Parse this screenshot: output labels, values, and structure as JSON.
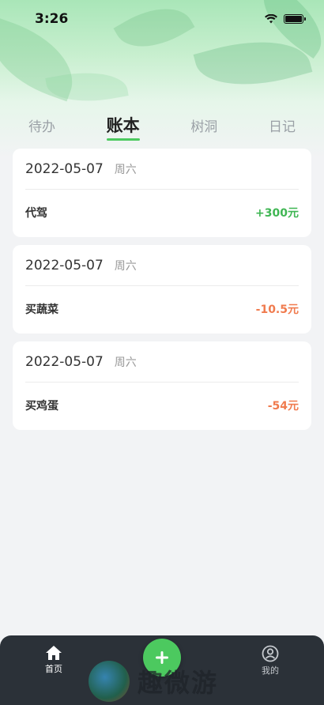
{
  "status_bar": {
    "time": "3:26"
  },
  "tabs": [
    {
      "label": "待办",
      "active": false
    },
    {
      "label": "账本",
      "active": true
    },
    {
      "label": "树洞",
      "active": false
    },
    {
      "label": "日记",
      "active": false
    }
  ],
  "entries": [
    {
      "date": "2022-05-07",
      "weekday": "周六",
      "item": "代驾",
      "amount": "+300元",
      "type": "income"
    },
    {
      "date": "2022-05-07",
      "weekday": "周六",
      "item": "买蔬菜",
      "amount": "-10.5元",
      "type": "expense"
    },
    {
      "date": "2022-05-07",
      "weekday": "周六",
      "item": "买鸡蛋",
      "amount": "-54元",
      "type": "expense"
    }
  ],
  "tabbar": {
    "home_label": "首页",
    "mine_label": "我的",
    "add_icon": "plus-icon"
  },
  "watermark": {
    "text": "趣微游"
  },
  "colors": {
    "accent": "#4cc95f",
    "income": "#3fb653",
    "expense": "#f07b4e",
    "tabbar_bg": "#2b3138"
  }
}
